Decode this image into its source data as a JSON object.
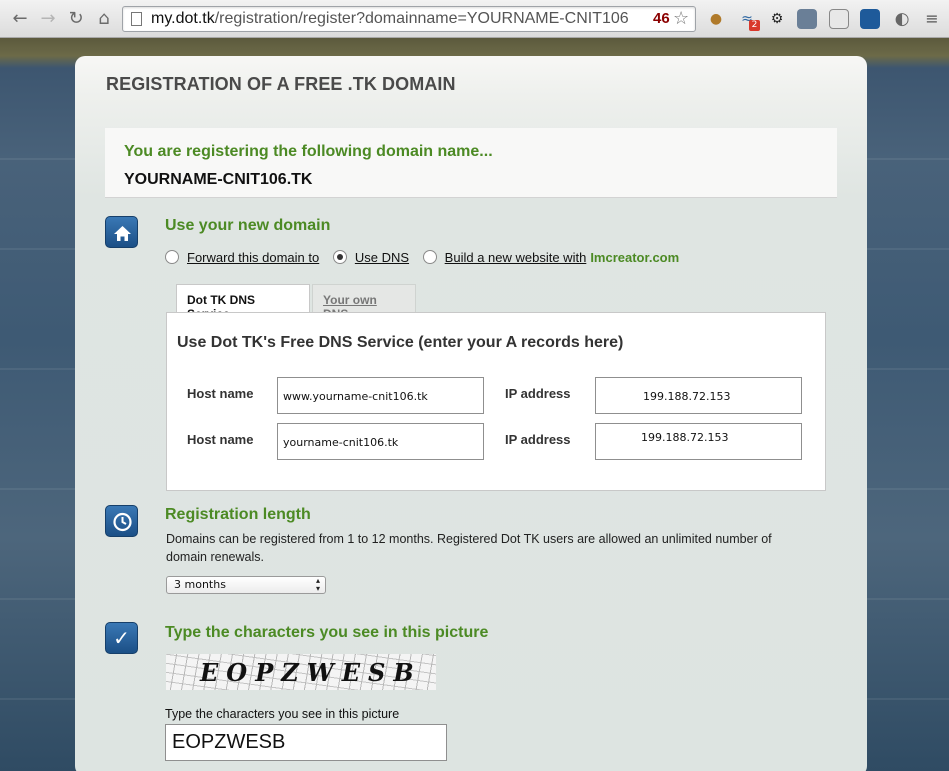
{
  "browser": {
    "url_host": "my.dot.tk",
    "url_path": "/registration/register?domainname=YOURNAME-CNIT106",
    "extension_badge_count": "2",
    "omnibox_badge": "46"
  },
  "page": {
    "title": "REGISTRATION OF A FREE .TK DOMAIN",
    "notice": {
      "line1": "You are registering the following domain name...",
      "domain": "YOURNAME-CNIT106.TK"
    },
    "use_domain": {
      "title": "Use your new domain",
      "options": [
        {
          "label": "Forward this domain to",
          "checked": false
        },
        {
          "label": "Use DNS",
          "checked": true
        },
        {
          "label": "Build a new website with",
          "checked": false
        }
      ],
      "brand_link": "Imcreator.com",
      "tabs": [
        "Dot TK DNS Service",
        "Your own DNS"
      ],
      "dns_title": "Use Dot TK's Free DNS Service (enter your A records here)",
      "records": [
        {
          "host_label": "Host name",
          "host_value": "www.yourname-cnit106.tk",
          "ip_label": "IP address",
          "ip_value": "199.188.72.153"
        },
        {
          "host_label": "Host name",
          "host_value": "yourname-cnit106.tk",
          "ip_label": "IP address",
          "ip_value": "199.188.72.153"
        }
      ]
    },
    "registration_length": {
      "title": "Registration length",
      "description": "Domains can be registered from 1 to 12 months. Registered Dot TK users are allowed an unlimited number of domain renewals.",
      "selected": "3 months"
    },
    "captcha": {
      "title": "Type the characters you see in this picture",
      "image_text": "EOPZWESB",
      "input_label": "Type the characters you see in this picture",
      "input_value": "EOPZWESB"
    }
  },
  "colors": {
    "accent_green": "#4c8a24",
    "icon_blue": "#2a64a0"
  }
}
